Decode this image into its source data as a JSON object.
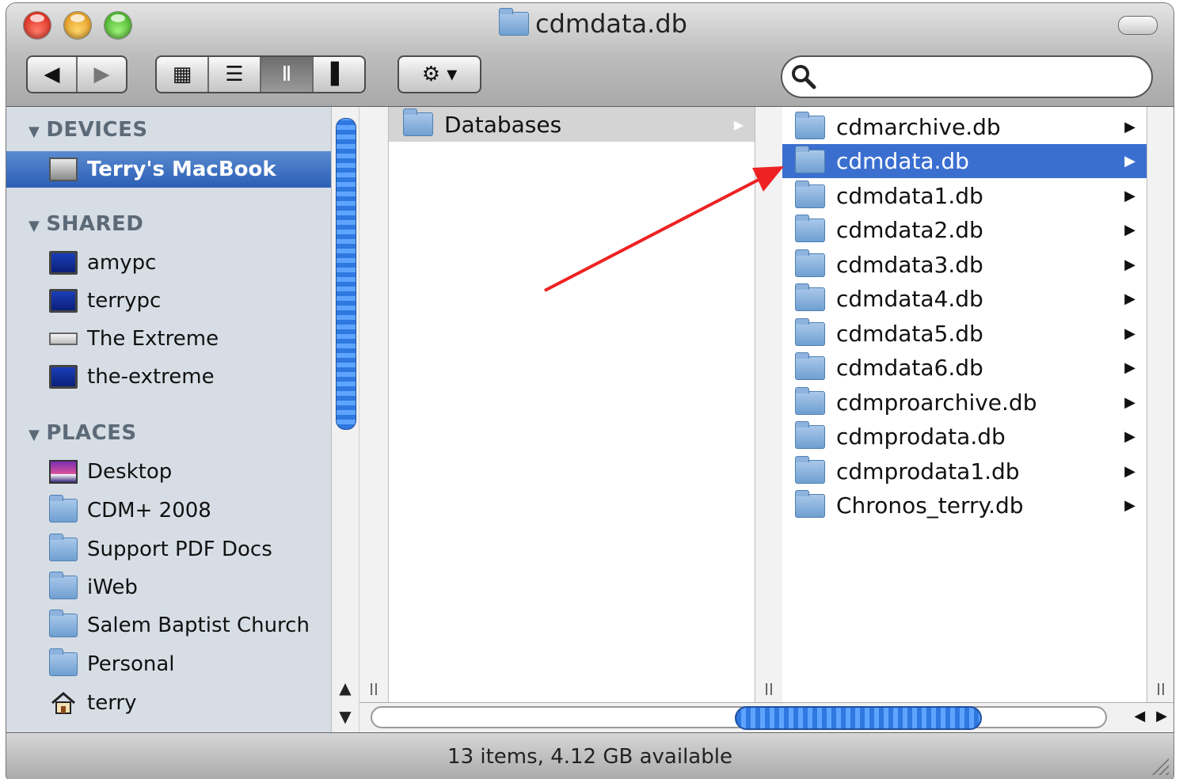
{
  "window": {
    "title": "cdmdata.db"
  },
  "toolbar": {
    "back": "◀",
    "forward": "▶",
    "view_icon": "▦",
    "view_list": "☰",
    "view_column": "Ⅱ",
    "view_coverflow": "▌",
    "action": "⚙ ▾",
    "search_placeholder": ""
  },
  "sidebar": {
    "devices": {
      "header": "DEVICES",
      "items": [
        {
          "label": "Terry's MacBook",
          "icon": "laptop-icon"
        }
      ]
    },
    "shared": {
      "header": "SHARED",
      "items": [
        {
          "label": "amypc",
          "icon": "monitor-icon"
        },
        {
          "label": "terrypc",
          "icon": "monitor-icon"
        },
        {
          "label": "The Extreme",
          "icon": "drive-icon"
        },
        {
          "label": "the-extreme",
          "icon": "monitor-icon"
        }
      ]
    },
    "places": {
      "header": "PLACES",
      "items": [
        {
          "label": "Desktop",
          "icon": "desktop-icon"
        },
        {
          "label": "CDM+ 2008",
          "icon": "folder-icon"
        },
        {
          "label": "Support PDF Docs",
          "icon": "folder-icon"
        },
        {
          "label": "iWeb",
          "icon": "folder-icon"
        },
        {
          "label": "Salem Baptist Church",
          "icon": "folder-icon"
        },
        {
          "label": "Personal",
          "icon": "folder-icon"
        },
        {
          "label": "terry",
          "icon": "home-icon"
        }
      ]
    }
  },
  "columns": {
    "col2": {
      "items": [
        {
          "label": "Databases"
        }
      ]
    },
    "col3": {
      "selected": "cdmdata.db",
      "items": [
        {
          "label": "cdmarchive.db"
        },
        {
          "label": "cdmdata.db"
        },
        {
          "label": "cdmdata1.db"
        },
        {
          "label": "cdmdata2.db"
        },
        {
          "label": "cdmdata3.db"
        },
        {
          "label": "cdmdata4.db"
        },
        {
          "label": "cdmdata5.db"
        },
        {
          "label": "cdmdata6.db"
        },
        {
          "label": "cdmproarchive.db"
        },
        {
          "label": "cdmprodata.db"
        },
        {
          "label": "cdmprodata1.db"
        },
        {
          "label": "Chronos_terry.db"
        }
      ]
    },
    "grip": "II"
  },
  "status": {
    "text": "13 items, 4.12 GB available"
  },
  "colors": {
    "selection": "#3a6fd0",
    "annotation_arrow": "#ee2222",
    "sidebar_bg": "#d6dde5"
  }
}
